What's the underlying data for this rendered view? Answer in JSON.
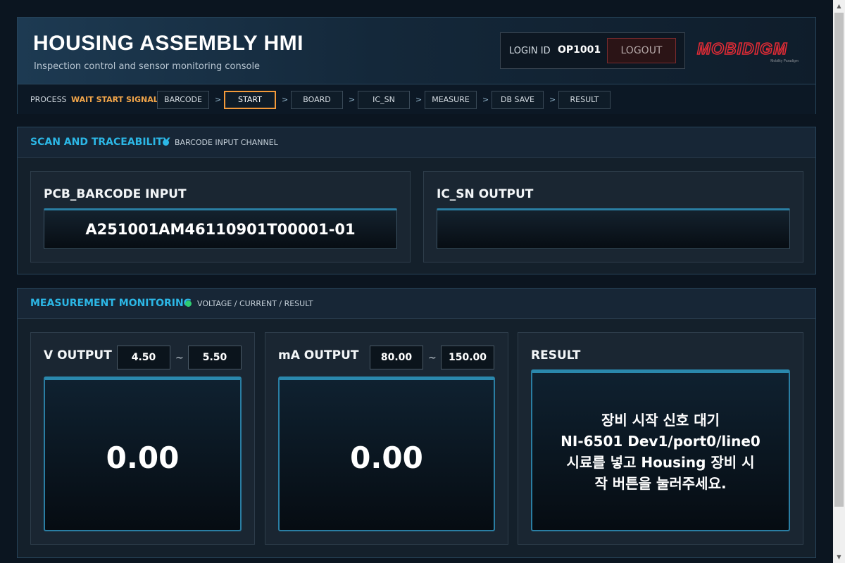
{
  "header": {
    "title": "HOUSING ASSEMBLY HMI",
    "subtitle": "Inspection control and sensor monitoring console",
    "login_label": "LOGIN ID",
    "login_id": "OP1001",
    "logout_label": "LOGOUT",
    "logo_text": "MOBIDIGM",
    "logo_tagline": "Mobility Paradigm",
    "logo_color": "#e02b35"
  },
  "process": {
    "label": "PROCESS",
    "status": "WAIT START SIGNAL",
    "status_color": "#f3a64a",
    "steps": [
      "BARCODE",
      "START",
      "BOARD",
      "IC_SN",
      "MEASURE",
      "DB SAVE",
      "RESULT"
    ],
    "active_step": "START",
    "separator": ">"
  },
  "scan_panel": {
    "title": "SCAN AND TRACEABILITY",
    "subtitle": "BARCODE INPUT CHANNEL",
    "indicator_color": "#2cb7e6",
    "pcb_barcode": {
      "label": "PCB_BARCODE INPUT",
      "value": "A251001AM46110901T00001-01"
    },
    "ic_sn": {
      "label": "IC_SN OUTPUT",
      "value": ""
    }
  },
  "measure_panel": {
    "title": "MEASUREMENT MONITORING",
    "subtitle": "VOLTAGE / CURRENT / RESULT",
    "indicator_color": "#2ecc71",
    "range_separator": "~",
    "v_output": {
      "label": "V OUTPUT",
      "min": "4.50",
      "max": "5.50",
      "value": "0.00"
    },
    "ma_output": {
      "label": "mA OUTPUT",
      "min": "80.00",
      "max": "150.00",
      "value": "0.00"
    },
    "result": {
      "label": "RESULT",
      "lines": [
        "장비 시작 신호 대기",
        "NI-6501 Dev1/port0/line0",
        "시료를 넣고 Housing 장비 시",
        "작 버튼을 눌러주세요."
      ]
    }
  }
}
